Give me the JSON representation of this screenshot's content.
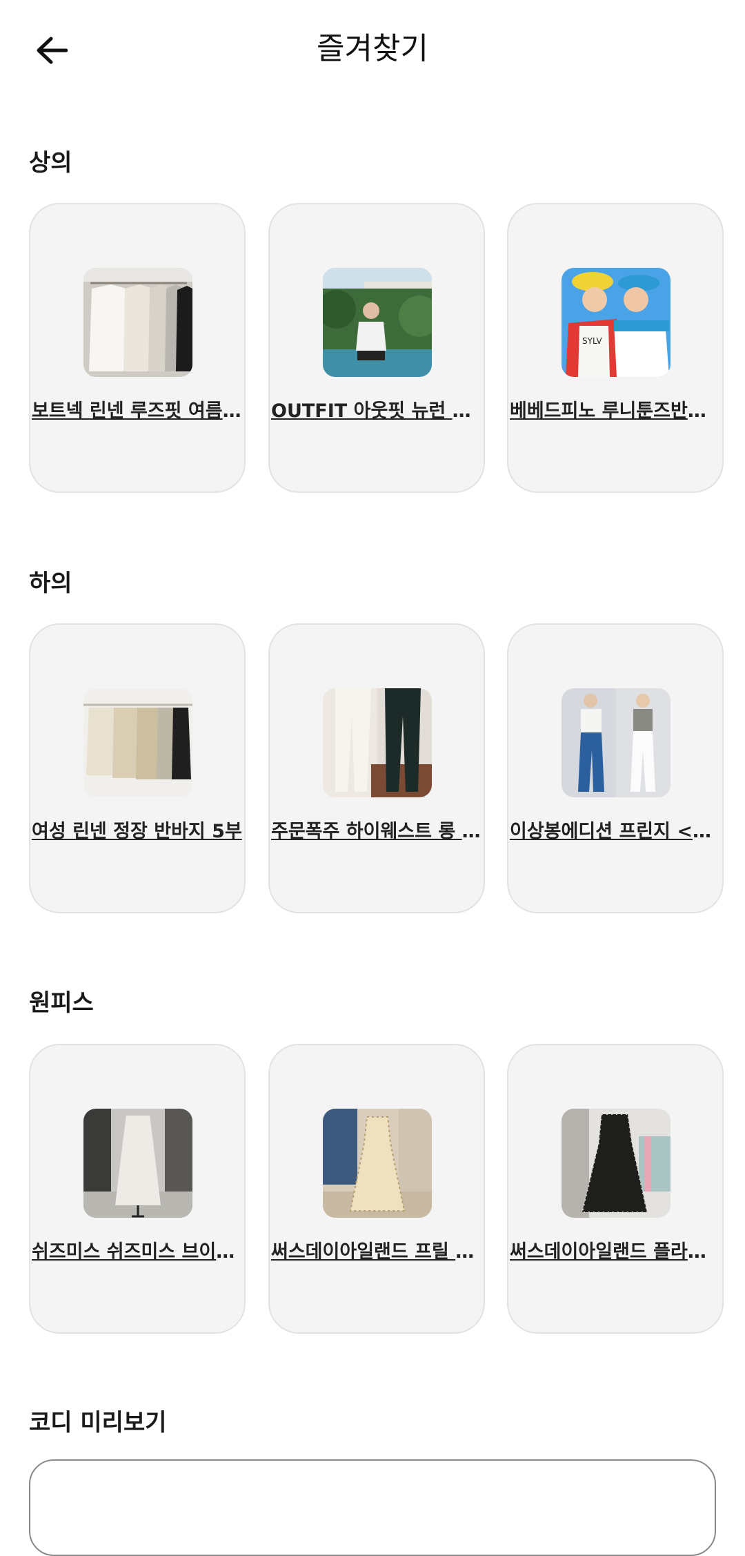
{
  "header": {
    "title": "즐겨찾기",
    "back_icon": "arrow-left-icon"
  },
  "sections": [
    {
      "title": "상의",
      "items": [
        {
          "label": "보트넥 린넨 루즈핏 여름니트"
        },
        {
          "label": "OUTFIT 아웃핏 뉴런 <b>오버핏 맨투맨</b>"
        },
        {
          "label": "베베드피노 루니툰즈반팔티셔츠"
        }
      ]
    },
    {
      "title": "하의",
      "items": [
        {
          "label": "여성 린넨 정장 반바지 5부"
        },
        {
          "label": "주문폭주 하이웨스트 롱 팬츠"
        },
        {
          "label": "이상봉에디션 프린지 <b>데님 팬츠</b>"
        }
      ]
    },
    {
      "title": "원피스",
      "items": [
        {
          "label": "쉬즈미스 쉬즈미스 브이넥 원피스"
        },
        {
          "label": "써스데이아일랜드 프릴 원피스"
        },
        {
          "label": "써스데이아일랜드 플라워 원피스"
        }
      ]
    }
  ],
  "preview": {
    "title": "코디 미리보기"
  },
  "colors": {
    "card_bg": "#f4f4f4",
    "card_border": "#e2e2e2",
    "text": "#1a1a1a"
  }
}
